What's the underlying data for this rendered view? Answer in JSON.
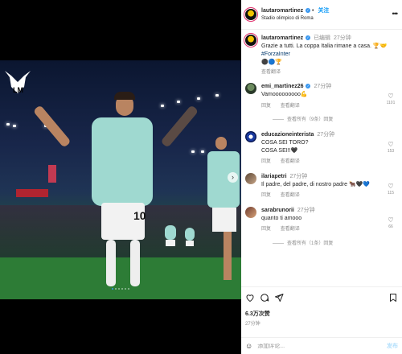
{
  "author": {
    "username": "lautaromartinez",
    "follow_label": "关注",
    "location": "Stadio olimpico di Roma",
    "more_label": "•••"
  },
  "caption": {
    "username": "lautaromartinez",
    "edited": "已编辑",
    "time": "27分钟",
    "text": "Grazie a tutti. La coppa Italia rimane a casa. ",
    "emoji": "🏆🤝",
    "hashtag": "#ForzaInter",
    "emoji2": "⚫🔵🏆",
    "translate": "查看翻译"
  },
  "comments": [
    {
      "username": "emi_martinez26",
      "time": "27分钟",
      "lines": [
        "Vamooooooooo💪"
      ],
      "reply": "回复",
      "translate": "查看翻译",
      "likes": "1101",
      "view_replies": "查看所有（9条）回复"
    },
    {
      "username": "educazioneinterista",
      "time": "27分钟",
      "lines": [
        "COSA SEI TORO?",
        "COSA SEI!!🖤"
      ],
      "reply": "回复",
      "translate": "查看翻译",
      "likes": "153",
      "view_replies": ""
    },
    {
      "username": "ilariapetri",
      "time": "27分钟",
      "lines": [
        "Il padre, del padre, di nostro padre 🐂🖤💙"
      ],
      "reply": "回复",
      "translate": "查看翻译",
      "likes": "115",
      "view_replies": ""
    },
    {
      "username": "sarabrunorii",
      "time": "27分钟",
      "lines": [
        "quanto ti amooo"
      ],
      "reply": "回复",
      "translate": "查看翻译",
      "likes": "66",
      "view_replies": "查看所有（1条）回复"
    }
  ],
  "post": {
    "likes": "6.3万次赞",
    "time": "27分钟"
  },
  "add_comment": {
    "emoji": "☺",
    "placeholder": "添加评论...",
    "post_label": "发布"
  },
  "media": {
    "next_label": "›",
    "slide_count": 6,
    "active_slide": 1
  },
  "icons": {
    "heart": "heart-icon",
    "comment": "comment-icon",
    "share": "share-icon",
    "save": "bookmark-icon"
  },
  "colors": {
    "accent": "#0095f6",
    "verified": "#3897f0",
    "shirt": "#9fd9d0"
  }
}
